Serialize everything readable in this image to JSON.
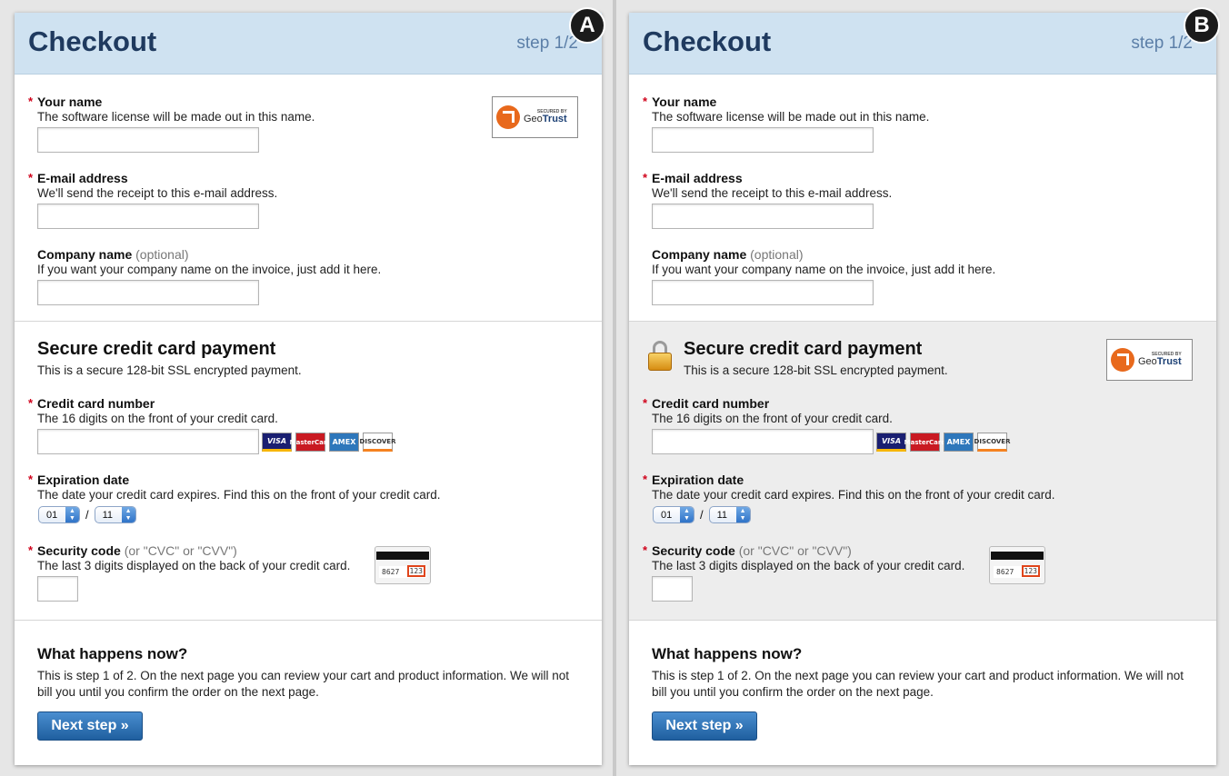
{
  "panels": {
    "a": {
      "badge": "A"
    },
    "b": {
      "badge": "B"
    }
  },
  "header": {
    "title": "Checkout",
    "step": "step 1/2"
  },
  "geotrust": {
    "small": "SECURED BY",
    "name_prefix": "Geo",
    "name_suffix": "Trust"
  },
  "fields": {
    "name": {
      "required": "*",
      "label": "Your name",
      "hint": "The software license will be made out in this name.",
      "value": ""
    },
    "email": {
      "required": "*",
      "label": "E-mail address",
      "hint": "We'll send the receipt to this e-mail address.",
      "value": ""
    },
    "company": {
      "label": "Company name",
      "optional": "(optional)",
      "hint": "If you want your company name on the invoice, just add it here.",
      "value": ""
    }
  },
  "payment": {
    "title": "Secure credit card payment",
    "desc": "This is a secure 128-bit SSL encrypted payment.",
    "card_number": {
      "required": "*",
      "label": "Credit card number",
      "hint": "The 16 digits on the front of your credit card.",
      "value": ""
    },
    "cards": [
      "VISA",
      "MasterCard",
      "AMEX",
      "DISCOVER"
    ],
    "expiration": {
      "required": "*",
      "label": "Expiration date",
      "hint": "The date your credit card expires. Find this on the front of your credit card.",
      "month": "01",
      "separator": "/",
      "year": "11"
    },
    "security": {
      "required": "*",
      "label": "Security code",
      "optional": "(or \"CVC\" or \"CVV\")",
      "hint": "The last 3 digits displayed on the back of your credit card.",
      "card_digits": "8627",
      "cvc": "123",
      "value": ""
    }
  },
  "next": {
    "title": "What happens now?",
    "text": "This is step 1 of 2. On the next page you can review your cart and product information. We will not bill you until you confirm the order on the next page.",
    "button": "Next step »"
  }
}
